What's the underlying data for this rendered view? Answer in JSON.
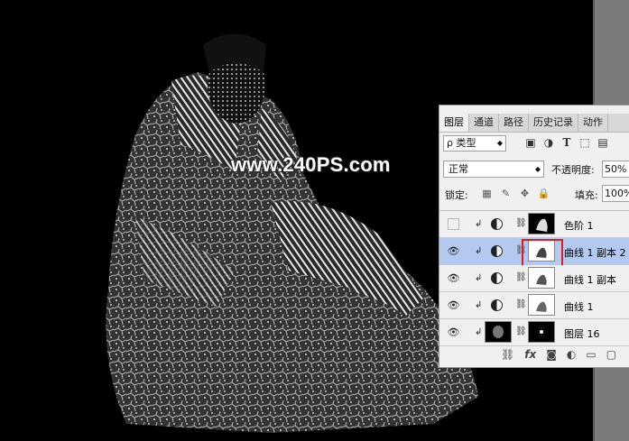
{
  "watermark": "www.240PS.com",
  "panel": {
    "tabs": [
      {
        "label": "图层",
        "active": true
      },
      {
        "label": "通道"
      },
      {
        "label": "路径"
      },
      {
        "label": "历史记录"
      },
      {
        "label": "动作"
      }
    ],
    "filter": {
      "kind_label": "ρ 类型",
      "icons": [
        "image-filter-icon",
        "adjustment-filter-icon",
        "type-filter-icon",
        "shape-filter-icon",
        "smart-object-filter-icon"
      ]
    },
    "blend_mode": "正常",
    "opacity_label": "不透明度:",
    "opacity_value": "50%",
    "lock_label": "锁定:",
    "fill_label": "填充:",
    "fill_value": "100%",
    "layers": [
      {
        "name": "色阶 1",
        "visible": false,
        "selected": false,
        "type": "adjustment"
      },
      {
        "name": "曲线 1 副本 2",
        "visible": true,
        "selected": true,
        "type": "adjustment",
        "highlighted_mask": true
      },
      {
        "name": "曲线 1 副本",
        "visible": true,
        "selected": false,
        "type": "adjustment"
      },
      {
        "name": "曲线 1",
        "visible": true,
        "selected": false,
        "type": "adjustment"
      },
      {
        "name": "图层 16",
        "visible": true,
        "selected": false,
        "type": "pixel"
      }
    ],
    "bottom_icons": [
      "link-icon",
      "fx-icon",
      "mask-icon",
      "adjustment-icon",
      "folder-icon",
      "new-layer-icon"
    ]
  },
  "colors": {
    "selection": "#b4c9ef",
    "highlight": "#e01b1b",
    "gutter": "#7a7a7a"
  }
}
